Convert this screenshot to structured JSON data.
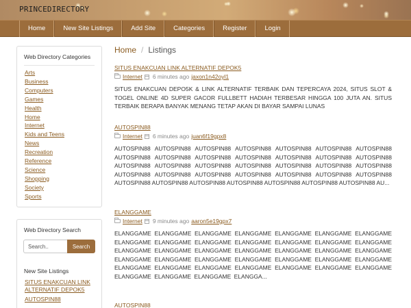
{
  "site": {
    "title": "PRINCEDIRECTORY"
  },
  "nav": {
    "items": [
      {
        "label": "Home"
      },
      {
        "label": "New Site Listings"
      },
      {
        "label": "Add Site"
      },
      {
        "label": "Categories"
      },
      {
        "label": "Register"
      },
      {
        "label": "Login"
      }
    ]
  },
  "sidebar": {
    "categories_heading": "Web Directory Categories",
    "categories": [
      "Arts",
      "Business",
      "Computers",
      "Games",
      "Health",
      "Home",
      "Internet",
      "Kids and Teens",
      "News",
      "Recreation",
      "Reference",
      "Science",
      "Shopping",
      "Society",
      "Sports"
    ],
    "search_heading": "Web Directory Search",
    "search_placeholder": "Search..",
    "search_button": "Search",
    "new_listings_heading": "New Site Listings",
    "new_listings": [
      "SITUS ENAKCUAN LINK ALTERNATIF DEPOK5",
      "AUTOSPIN88"
    ]
  },
  "breadcrumb": {
    "home": "Home",
    "separator": "/",
    "current": "Listings"
  },
  "listings": [
    {
      "title": "SITUS ENAKCUAN LINK ALTERNATIF DEPOK5",
      "category": "Internet",
      "time": "6 minutes ago",
      "author": "jaxon1n42oyl1",
      "description": "SITUS ENAKCUAN DEPO5K & LINK ALTERNATIF TERBAIK DAN TEPERCAYA 2024, SITUS SLOT & TOGEL ONLINE 4D SUPER GACOR FULLBETT HADIAH TERBESAR HINGGA 100 JUTA AN. SITUS TERBAIK BERAPA BANYAK MENANG TETAP AKAN DI BAYAR SAMPAI LUNAS"
    },
    {
      "title": "AUTOSPIN88",
      "category": "Internet",
      "time": "6 minutes ago",
      "author": "juan6f19gpx8",
      "description": "AUTOSPIN88 AUTOSPIN88 AUTOSPIN88 AUTOSPIN88 AUTOSPIN88 AUTOSPIN88 AUTOSPIN88 AUTOSPIN88 AUTOSPIN88 AUTOSPIN88 AUTOSPIN88 AUTOSPIN88 AUTOSPIN88 AUTOSPIN88 AUTOSPIN88 AUTOSPIN88 AUTOSPIN88 AUTOSPIN88 AUTOSPIN88 AUTOSPIN88 AUTOSPIN88 AUTOSPIN88 AUTOSPIN88 AUTOSPIN88 AUTOSPIN88 AUTOSPIN88 AUTOSPIN88 AUTOSPIN88 AUTOSPIN88 AUTOSPIN88 AUTOSPIN88 AUTOSPIN88 AUTOSPIN88 AUTOSPIN88 AUTOSPIN88 AU..."
    },
    {
      "title": "ELANGGAME",
      "category": "Internet",
      "time": "9 minutes ago",
      "author": "aaron5e19gpx7",
      "description": "ELANGGAME ELANGGAME ELANGGAME ELANGGAME ELANGGAME ELANGGAME ELANGGAME ELANGGAME ELANGGAME ELANGGAME ELANGGAME ELANGGAME ELANGGAME ELANGGAME ELANGGAME ELANGGAME ELANGGAME ELANGGAME ELANGGAME ELANGGAME ELANGGAME ELANGGAME ELANGGAME ELANGGAME ELANGGAME ELANGGAME ELANGGAME ELANGGAME ELANGGAME ELANGGAME ELANGGAME ELANGGAME ELANGGAME ELANGGAME ELANGGAME ELANGGAME ELANGGAME ELANGGAME ELANGGA..."
    },
    {
      "title": "AUTOSPIN88"
    }
  ]
}
